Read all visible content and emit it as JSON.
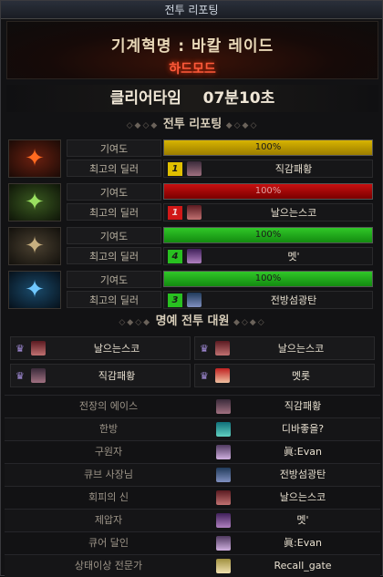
{
  "window": {
    "title": "전투 리포팅"
  },
  "header": {
    "raid_name": "기계혁명 : 바칼 레이드",
    "mode": "하드모드"
  },
  "clear_time": {
    "label": "클리어타임",
    "value": "07분10초"
  },
  "sections": {
    "battle_report": "전투 리포팅",
    "honor": "명예 전투 대원"
  },
  "labels": {
    "contribution": "기여도",
    "best_dealer": "최고의 딜러"
  },
  "colors": {
    "party1": "#c8a000",
    "party2": "#b00000",
    "party3": "#1fa818",
    "party4": "#1fa818"
  },
  "parties": [
    {
      "icon": "fire-emblem-icon",
      "contribution": "100%",
      "contribution_value": 100,
      "rank": "1",
      "dealer": "직감패황"
    },
    {
      "icon": "wind-emblem-icon",
      "contribution": "100%",
      "contribution_value": 100,
      "rank": "1",
      "dealer": "날으는스코"
    },
    {
      "icon": "metal-emblem-icon",
      "contribution": "100%",
      "contribution_value": 100,
      "rank": "4",
      "dealer": "멧'"
    },
    {
      "icon": "ice-emblem-icon",
      "contribution": "100%",
      "contribution_value": 100,
      "rank": "3",
      "dealer": "전방섬광탄"
    }
  ],
  "honor_members": [
    "날으는스코",
    "날으는스코",
    "직감패황",
    "멧롯"
  ],
  "awards": [
    {
      "title": "전장의 에이스",
      "name": "직감패황"
    },
    {
      "title": "한방",
      "name": "디바좋을?"
    },
    {
      "title": "구원자",
      "name": "眞:Evan"
    },
    {
      "title": "큐브 사장님",
      "name": "전방섬광탄"
    },
    {
      "title": "회피의 신",
      "name": "날으는스코"
    },
    {
      "title": "제압자",
      "name": "멧'"
    },
    {
      "title": "큐어 달인",
      "name": "眞:Evan"
    },
    {
      "title": "상태이상 전문가",
      "name": "Recall_gate"
    }
  ]
}
